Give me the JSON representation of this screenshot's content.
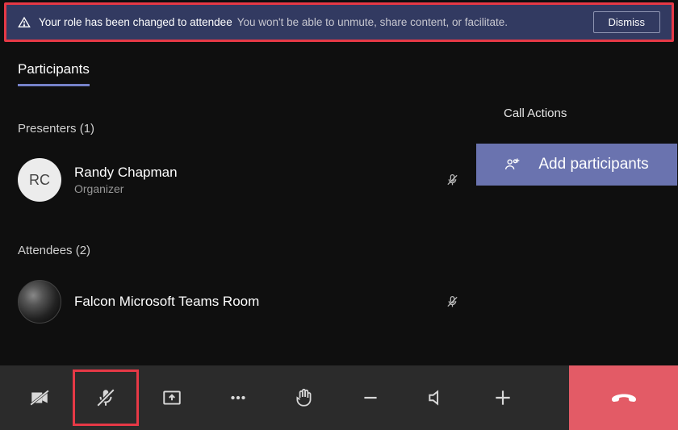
{
  "banner": {
    "title": "Your role has been changed to attendee",
    "subtitle": "You won't be able to unmute, share content, or facilitate.",
    "dismiss_label": "Dismiss"
  },
  "tabs": {
    "participants": "Participants"
  },
  "call_actions": {
    "heading": "Call Actions",
    "add_participants_label": "Add participants"
  },
  "presenters": {
    "heading": "Presenters (1)",
    "items": [
      {
        "initials": "RC",
        "name": "Randy Chapman",
        "role": "Organizer"
      }
    ]
  },
  "attendees": {
    "heading": "Attendees (2)",
    "items": [
      {
        "name": "Falcon Microsoft Teams Room"
      }
    ]
  }
}
